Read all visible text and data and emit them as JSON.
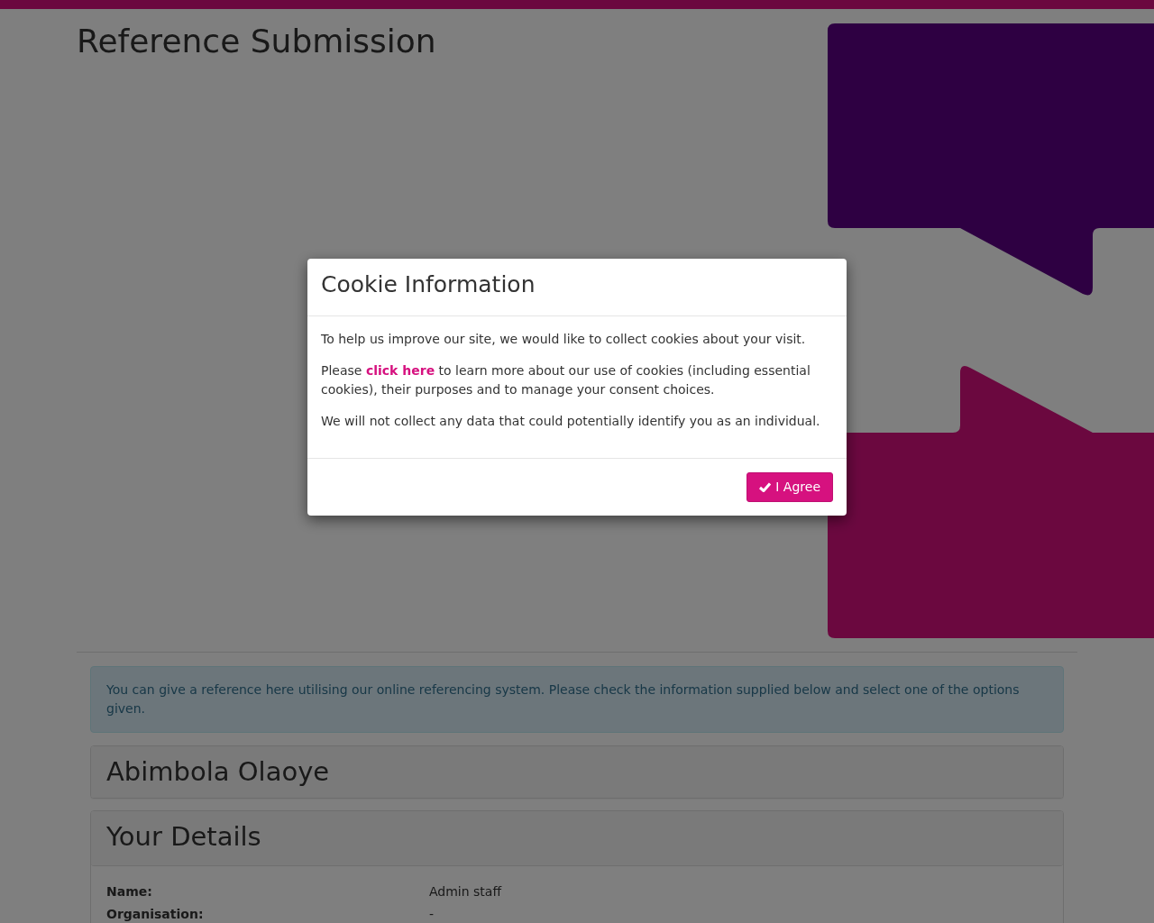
{
  "page_title": "Reference Submission",
  "info_alert": "You can give a reference here utilising our online referencing system. Please check the information supplied below and select one of the options given.",
  "applicant_card": {
    "title": "Abimbola Olaoye"
  },
  "details_card": {
    "title": "Your Details",
    "fields": [
      {
        "label": "Name:",
        "value": "Admin staff"
      },
      {
        "label": "Organisation:",
        "value": "-"
      }
    ]
  },
  "modal": {
    "title": "Cookie Information",
    "paragraphs": [
      {
        "kind": "plain",
        "text": "To help us improve our site, we would like to collect cookies about your visit."
      },
      {
        "kind": "link",
        "before": "Please ",
        "link": "click here",
        "after": " to learn more about our use of cookies (including essential cookies), their purposes and to manage your consent choices."
      },
      {
        "kind": "plain",
        "text": "We will not collect any data that could potentially identify you as an individual."
      }
    ],
    "button": "I Agree"
  }
}
